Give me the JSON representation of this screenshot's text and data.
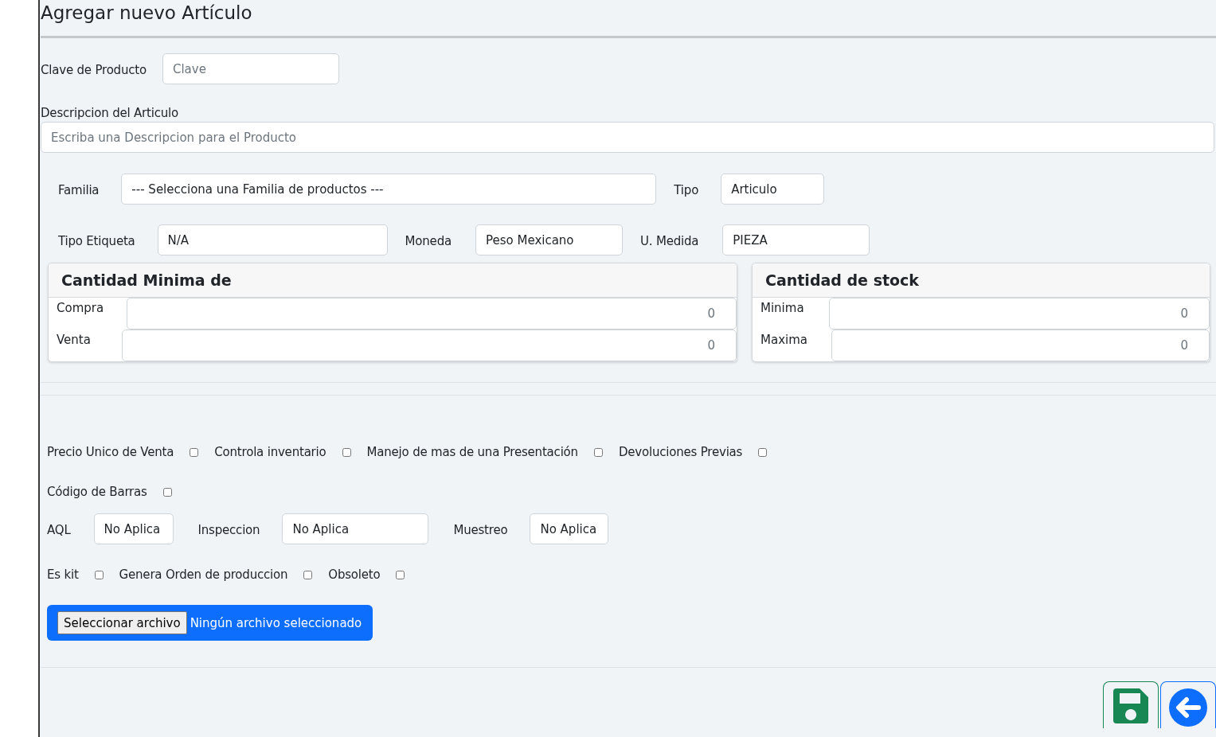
{
  "title": "Agregar nuevo Artículo",
  "clave": {
    "label": "Clave de Producto",
    "placeholder": "Clave"
  },
  "descripcion": {
    "label": "Descripcion del Articulo",
    "placeholder": "Escriba una Descripcion para el Producto"
  },
  "field_rows": [
    {
      "fields": [
        {
          "label": "Familia",
          "value": "--- Selecciona una Familia de productos ---"
        },
        {
          "label": "Tipo",
          "value": "Articulo"
        }
      ]
    },
    {
      "fields": [
        {
          "label": "Tipo Etiqueta",
          "value": "N/A"
        },
        {
          "label": "Moneda",
          "value": "Peso Mexicano"
        },
        {
          "label": "U. Medida",
          "value": "PIEZA"
        }
      ]
    }
  ],
  "panels": [
    {
      "title": "Cantidad Minima de",
      "rows": [
        {
          "label": "Compra",
          "placeholder": "0"
        },
        {
          "label": "Venta",
          "placeholder": "0"
        }
      ]
    },
    {
      "title": "Cantidad de stock",
      "rows": [
        {
          "label": "Minima",
          "placeholder": "0"
        },
        {
          "label": "Maxima",
          "placeholder": "0"
        }
      ]
    }
  ],
  "check_rows_1": [
    {
      "items": [
        {
          "label": "Precio Unico de Venta",
          "checked": false
        },
        {
          "label": "Controla inventario",
          "checked": false
        },
        {
          "label": "Manejo de mas de una Presentación",
          "checked": false
        },
        {
          "label": "Devoluciones Previas",
          "checked": false
        }
      ]
    },
    {
      "items": [
        {
          "label": "Código de Barras",
          "checked": false
        }
      ]
    }
  ],
  "quality_fields": [
    {
      "label": "AQL",
      "value": "No Aplica"
    },
    {
      "label": "Inspeccion",
      "value": "No Aplica"
    },
    {
      "label": "Muestreo",
      "value": "No Aplica"
    }
  ],
  "check_rows_2": [
    {
      "items": [
        {
          "label": "Es kit",
          "checked": false
        },
        {
          "label": "Genera Orden de produccion",
          "checked": false
        },
        {
          "label": "Obsoleto",
          "checked": false
        }
      ]
    }
  ],
  "file_input": {
    "button": "Seleccionar archivo",
    "status": "Ningún archivo seleccionado"
  },
  "actions": [
    {
      "kind": "save"
    },
    {
      "kind": "back"
    }
  ]
}
